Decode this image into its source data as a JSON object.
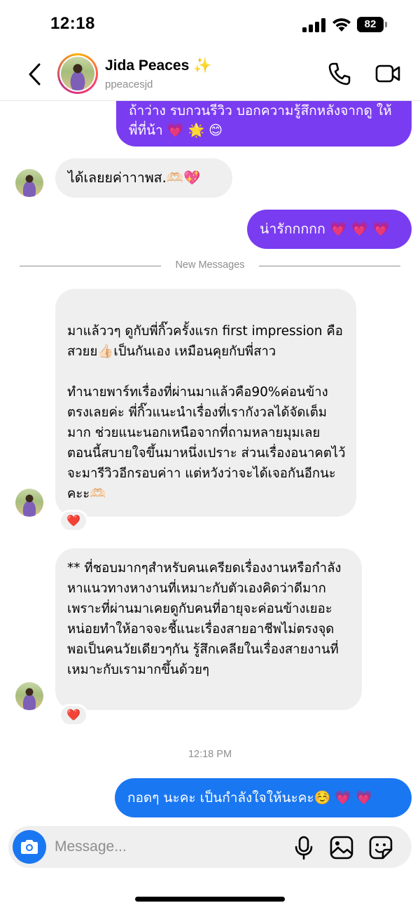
{
  "status_bar": {
    "time": "12:18",
    "battery": "82"
  },
  "header": {
    "name": "Jida Peaces ✨",
    "handle": "ppeacesjd"
  },
  "messages": {
    "m1": "ถ้าว่าง รบกวนรีวิว บอกความรู้สึกหลังจากดู ให้พี่ที่น้า 💗 🌟 😊",
    "m2": "ได้เลยยค่าาาพส.🫶🏻💖",
    "m3": "น่ารักกกกก 💗 💗 💗",
    "new_messages_label": "New Messages",
    "m4": "มาแล้ววๆ ดูกับพี่กิ๊วครั้งแรก first impression คือสวยย👍🏻เป็นกันเอง เหมือนคุยกับพี่สาว\n\nทำนายพาร์ทเรื่องที่ผ่านมาแล้วคือ90%ค่อนข้างตรงเลยค่ะ พี่กิ๊วแนะนำเรื่องที่เรากังวลได้จัดเต็มมาก ช่วยแนะนอกเหนือจากที่ถามหลายมุมเลย ตอนนี้สบายใจขึ้นมาหนึ่งเปราะ ส่วนเรื่องอนาคตไว้จะมารีวิวอีกรอบค่าา แต่หวังว่าจะได้เจอกันอีกนะคะะ🫶🏻",
    "m4_reaction": "❤️",
    "m5": "** ที่ชอบมากๆสำหรับคนเครียดเรื่องงานหรือกำลังหาแนวทางหางานที่เหมาะกับตัวเองคิดว่าดีมาก เพราะที่ผ่านมาเคยดูกับคนที่อายุจะค่อนข้างเยอะหน่อยทำให้อาจจะชี้แนะเรื่องสายอาชีพไม่ตรงจุด พอเป็นคนวัยเดียวๆกัน รู้สึกเคลียในเรื่องสายงานที่เหมาะกับเรามากขึ้นด้วยๆ",
    "m5_reaction": "❤️",
    "timestamp": "12:18 PM",
    "m6": "กอดๆ นะคะ เป็นกำลังใจให้นะคะ☺️ 💗 💗"
  },
  "composer": {
    "placeholder": "Message..."
  },
  "colors": {
    "bubble_purple": "#7a3cf0",
    "bubble_blue": "#1a77f2",
    "bubble_incoming": "#efefef"
  }
}
